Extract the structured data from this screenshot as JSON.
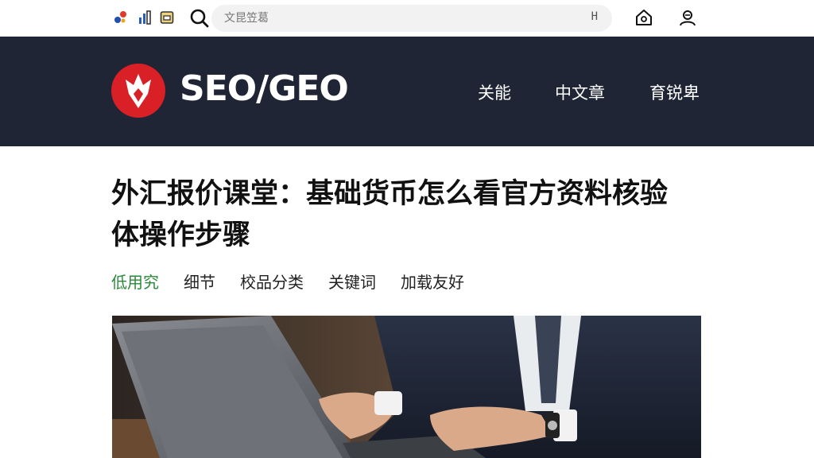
{
  "topbar": {
    "search_placeholder": "文昆笠葛",
    "search_suffix": "H"
  },
  "header": {
    "logo_text": "SEO/GEO",
    "nav": [
      "关能",
      "中文章",
      "育锐卑"
    ]
  },
  "article": {
    "title_line1": "外汇报价课堂：基础货币怎么看官方资料核验",
    "title_line2": "体操作步骤",
    "tags": [
      "低用究",
      "细节",
      "校品分类",
      "关键词",
      "加载友好"
    ],
    "active_tag_index": 0
  },
  "colors": {
    "header_bg": "#1f2535",
    "logo_red": "#d92026",
    "active_tag": "#2a8a3a"
  },
  "icons": [
    "app-icon-red",
    "stats-icon",
    "wallet-icon",
    "search-icon",
    "home-icon",
    "user-icon",
    "logo-mark-icon"
  ]
}
